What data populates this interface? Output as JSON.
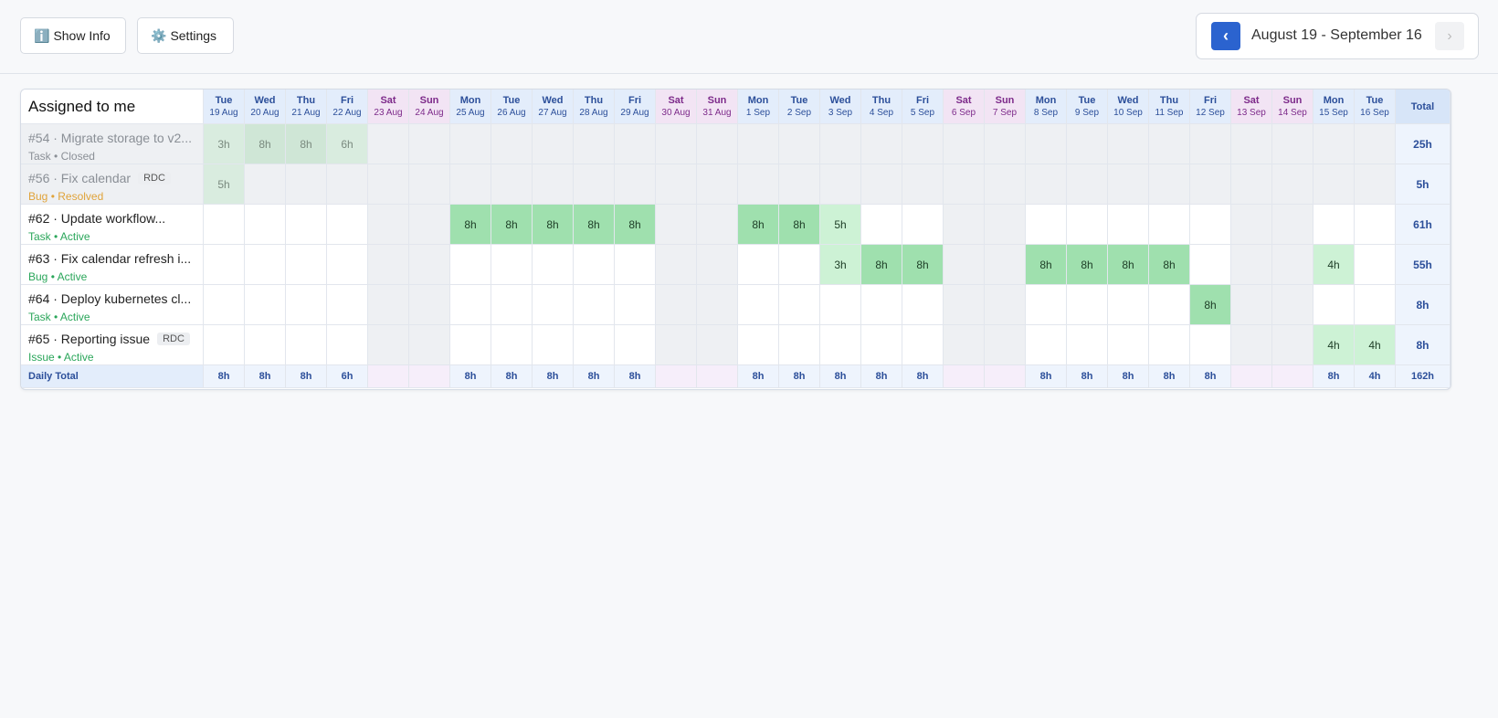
{
  "toolbar": {
    "show_info_label": "Show Info",
    "settings_label": "Settings",
    "date_range": "August 19 - September 16",
    "prev_symbol": "‹",
    "next_symbol": "›"
  },
  "grid": {
    "title": "Assigned to me",
    "total_label": "Total",
    "daily_total_label": "Daily Total",
    "grand_total": "162h",
    "days": [
      {
        "dow": "Tue",
        "date": "19 Aug",
        "weekend": false
      },
      {
        "dow": "Wed",
        "date": "20 Aug",
        "weekend": false
      },
      {
        "dow": "Thu",
        "date": "21 Aug",
        "weekend": false
      },
      {
        "dow": "Fri",
        "date": "22 Aug",
        "weekend": false
      },
      {
        "dow": "Sat",
        "date": "23 Aug",
        "weekend": true
      },
      {
        "dow": "Sun",
        "date": "24 Aug",
        "weekend": true
      },
      {
        "dow": "Mon",
        "date": "25 Aug",
        "weekend": false
      },
      {
        "dow": "Tue",
        "date": "26 Aug",
        "weekend": false
      },
      {
        "dow": "Wed",
        "date": "27 Aug",
        "weekend": false
      },
      {
        "dow": "Thu",
        "date": "28 Aug",
        "weekend": false
      },
      {
        "dow": "Fri",
        "date": "29 Aug",
        "weekend": false
      },
      {
        "dow": "Sat",
        "date": "30 Aug",
        "weekend": true
      },
      {
        "dow": "Sun",
        "date": "31 Aug",
        "weekend": true
      },
      {
        "dow": "Mon",
        "date": "1 Sep",
        "weekend": false
      },
      {
        "dow": "Tue",
        "date": "2 Sep",
        "weekend": false
      },
      {
        "dow": "Wed",
        "date": "3 Sep",
        "weekend": false
      },
      {
        "dow": "Thu",
        "date": "4 Sep",
        "weekend": false
      },
      {
        "dow": "Fri",
        "date": "5 Sep",
        "weekend": false
      },
      {
        "dow": "Sat",
        "date": "6 Sep",
        "weekend": true
      },
      {
        "dow": "Sun",
        "date": "7 Sep",
        "weekend": true
      },
      {
        "dow": "Mon",
        "date": "8 Sep",
        "weekend": false
      },
      {
        "dow": "Tue",
        "date": "9 Sep",
        "weekend": false
      },
      {
        "dow": "Wed",
        "date": "10 Sep",
        "weekend": false
      },
      {
        "dow": "Thu",
        "date": "11 Sep",
        "weekend": false
      },
      {
        "dow": "Fri",
        "date": "12 Sep",
        "weekend": false
      },
      {
        "dow": "Sat",
        "date": "13 Sep",
        "weekend": true
      },
      {
        "dow": "Sun",
        "date": "14 Sep",
        "weekend": true
      },
      {
        "dow": "Mon",
        "date": "15 Sep",
        "weekend": false
      },
      {
        "dow": "Tue",
        "date": "16 Sep",
        "weekend": false
      }
    ],
    "tasks": [
      {
        "title": "#54 · Migrate storage to v2...",
        "tag": "",
        "type": "Task",
        "status": "Closed",
        "status_color": "#8a8f96",
        "closed": true,
        "total": "25h",
        "hours": [
          "3h",
          "8h",
          "8h",
          "6h",
          "",
          "",
          "",
          "",
          "",
          "",
          "",
          "",
          "",
          "",
          "",
          "",
          "",
          "",
          "",
          "",
          "",
          "",
          "",
          "",
          "",
          "",
          "",
          "",
          ""
        ]
      },
      {
        "title": "#56 · Fix calendar",
        "tag": "RDC",
        "type": "Bug",
        "status": "Resolved",
        "status_color": "#e0a33a",
        "closed": true,
        "total": "5h",
        "hours": [
          "5h",
          "",
          "",
          "",
          "",
          "",
          "",
          "",
          "",
          "",
          "",
          "",
          "",
          "",
          "",
          "",
          "",
          "",
          "",
          "",
          "",
          "",
          "",
          "",
          "",
          "",
          "",
          "",
          ""
        ]
      },
      {
        "title": "#62 · Update workflow...",
        "tag": "",
        "type": "Task",
        "status": "Active",
        "status_color": "#2aa65a",
        "closed": false,
        "total": "61h",
        "hours": [
          "",
          "",
          "",
          "",
          "",
          "",
          "8h",
          "8h",
          "8h",
          "8h",
          "8h",
          "",
          "",
          "8h",
          "8h",
          "5h",
          "",
          "",
          "",
          "",
          "",
          "",
          "",
          "",
          "",
          "",
          "",
          "",
          ""
        ]
      },
      {
        "title": "#63 · Fix calendar refresh i...",
        "tag": "",
        "type": "Bug",
        "status": "Active",
        "status_color": "#2aa65a",
        "closed": false,
        "total": "55h",
        "hours": [
          "",
          "",
          "",
          "",
          "",
          "",
          "",
          "",
          "",
          "",
          "",
          "",
          "",
          "",
          "",
          "3h",
          "8h",
          "8h",
          "",
          "",
          "8h",
          "8h",
          "8h",
          "8h",
          "",
          "",
          "",
          "4h",
          ""
        ]
      },
      {
        "title": "#64 · Deploy kubernetes cl...",
        "tag": "",
        "type": "Task",
        "status": "Active",
        "status_color": "#2aa65a",
        "closed": false,
        "total": "8h",
        "hours": [
          "",
          "",
          "",
          "",
          "",
          "",
          "",
          "",
          "",
          "",
          "",
          "",
          "",
          "",
          "",
          "",
          "",
          "",
          "",
          "",
          "",
          "",
          "",
          "",
          "8h",
          "",
          "",
          "",
          ""
        ]
      },
      {
        "title": "#65 · Reporting issue",
        "tag": "RDC",
        "type": "Issue",
        "status": "Active",
        "status_color": "#2aa65a",
        "closed": false,
        "total": "8h",
        "hours": [
          "",
          "",
          "",
          "",
          "",
          "",
          "",
          "",
          "",
          "",
          "",
          "",
          "",
          "",
          "",
          "",
          "",
          "",
          "",
          "",
          "",
          "",
          "",
          "",
          "",
          "",
          "",
          "4h",
          "4h"
        ]
      }
    ],
    "daily_totals": [
      "8h",
      "8h",
      "8h",
      "6h",
      "",
      "",
      "8h",
      "8h",
      "8h",
      "8h",
      "8h",
      "",
      "",
      "8h",
      "8h",
      "8h",
      "8h",
      "8h",
      "",
      "",
      "8h",
      "8h",
      "8h",
      "8h",
      "8h",
      "",
      "",
      "8h",
      "4h"
    ]
  }
}
